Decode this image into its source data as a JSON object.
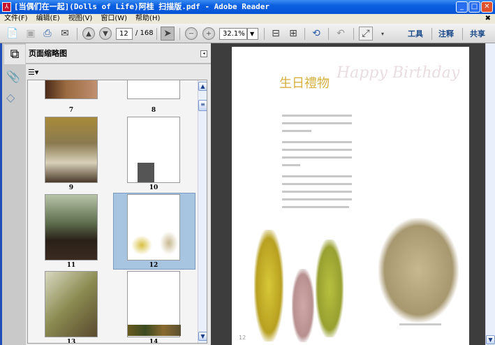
{
  "window": {
    "title": "[当偶们在一起](Dolls of Life)阿桂 扫描版.pdf - Adobe Reader",
    "app_icon": "adobe-reader-icon"
  },
  "menu": [
    "文件(F)",
    "编辑(E)",
    "视图(V)",
    "窗口(W)",
    "帮助(H)"
  ],
  "toolbar": {
    "current_page": "12",
    "total_pages": "/ 168",
    "zoom": "32.1%",
    "tools_label": "工具",
    "comment_label": "注释",
    "share_label": "共享"
  },
  "panel": {
    "title": "页面缩略图",
    "thumbnails": [
      {
        "label": "7"
      },
      {
        "label": "8"
      },
      {
        "label": "9"
      },
      {
        "label": "10"
      },
      {
        "label": "11"
      },
      {
        "label": "12",
        "selected": true
      },
      {
        "label": "13"
      },
      {
        "label": "14"
      }
    ]
  },
  "document": {
    "heading": "生日禮物",
    "script_title": "Happy Birthday",
    "page_number": "12",
    "heading_color": "#d7b040"
  },
  "colors": {
    "titlebar": "#0a5fe0",
    "selection": "#a7c4e0",
    "doc_background": "#3d3d3d"
  }
}
